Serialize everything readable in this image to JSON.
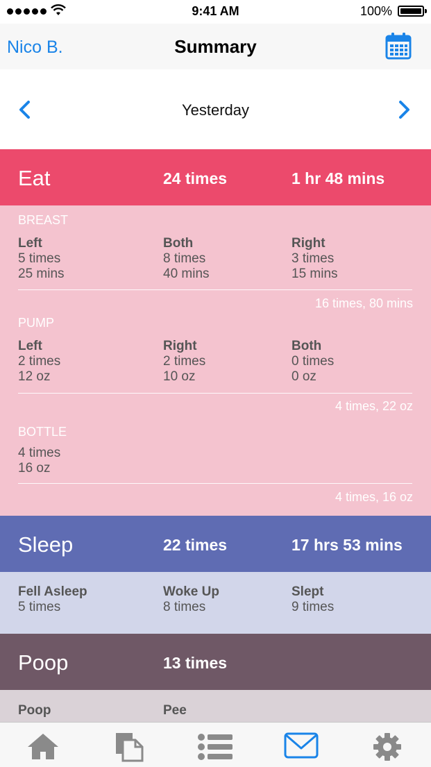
{
  "status_bar": {
    "time": "9:41 AM",
    "battery": "100%"
  },
  "nav": {
    "left": "Nico B.",
    "title": "Summary",
    "right_icon": "calendar-icon"
  },
  "date_nav": {
    "label": "Yesterday"
  },
  "eat": {
    "title": "Eat",
    "count": "24 times",
    "duration": "1 hr 48 mins",
    "breast": {
      "title": "BREAST",
      "cols": [
        {
          "label": "Left",
          "line1": "5 times",
          "line2": "25 mins"
        },
        {
          "label": "Both",
          "line1": "8 times",
          "line2": "40 mins"
        },
        {
          "label": "Right",
          "line1": "3 times",
          "line2": "15 mins"
        }
      ],
      "total": "16 times, 80 mins"
    },
    "pump": {
      "title": "PUMP",
      "cols": [
        {
          "label": "Left",
          "line1": "2 times",
          "line2": "12 oz"
        },
        {
          "label": "Right",
          "line1": "2 times",
          "line2": "10 oz"
        },
        {
          "label": "Both",
          "line1": "0 times",
          "line2": "0 oz"
        }
      ],
      "total": "4 times, 22 oz"
    },
    "bottle": {
      "title": "BOTTLE",
      "line1": "4 times",
      "line2": "16 oz",
      "total": "4 times, 16 oz"
    }
  },
  "sleep": {
    "title": "Sleep",
    "count": "22 times",
    "duration": "17 hrs 53 mins",
    "cols": [
      {
        "label": "Fell Asleep",
        "line1": "5 times"
      },
      {
        "label": "Woke Up",
        "line1": "8 times"
      },
      {
        "label": "Slept",
        "line1": "9 times"
      }
    ]
  },
  "poop": {
    "title": "Poop",
    "count": "13 times",
    "cols": [
      {
        "label": "Poop"
      },
      {
        "label": "Pee"
      }
    ]
  },
  "tabs": [
    {
      "icon": "home-icon",
      "active": false
    },
    {
      "icon": "documents-icon",
      "active": false
    },
    {
      "icon": "list-icon",
      "active": false
    },
    {
      "icon": "mail-icon",
      "active": true
    },
    {
      "icon": "gear-icon",
      "active": false
    }
  ],
  "colors": {
    "accent": "#1a84e8",
    "eat": "#ec4a6c",
    "eat_light": "#f4c3cf",
    "sleep": "#5f6cb3",
    "sleep_light": "#d2d6ea",
    "poop": "#6f5866",
    "poop_light": "#dad2d7"
  }
}
